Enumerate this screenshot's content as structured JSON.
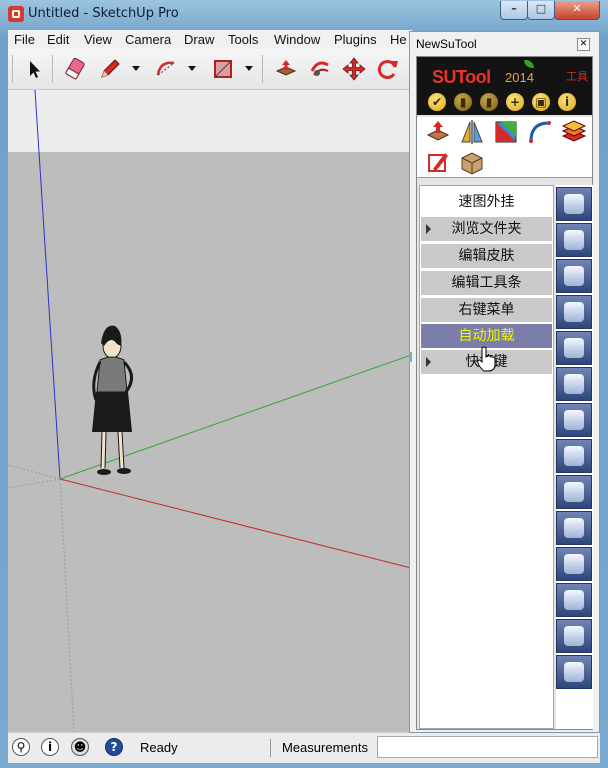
{
  "window": {
    "title": "Untitled - SketchUp Pro"
  },
  "menu": [
    "File",
    "Edit",
    "View",
    "Camera",
    "Draw",
    "Tools",
    "Window",
    "Plugins",
    "He"
  ],
  "toolbar": {
    "tools": [
      "select-tool",
      "eraser-tool",
      "pencil-tool",
      "arc-tool",
      "rectangle-tool",
      "push-pull-tool",
      "follow-me-tool",
      "move-tool",
      "rotate-tool"
    ]
  },
  "status": {
    "ready": "Ready",
    "measurements_label": "Measurements",
    "measurements_value": ""
  },
  "panel": {
    "title": "NewSuTool",
    "brand": "SUTool",
    "year": "2014",
    "tool_label": "工具",
    "quick_buttons": [
      "✔",
      "▮",
      "▮",
      "+",
      "▣",
      "i"
    ],
    "icon_grid": [
      "upload-arrow",
      "mirror-triangle",
      "map-square",
      "arc-curve",
      "layers",
      "pen-brush",
      "box-tool"
    ],
    "menu_items": [
      {
        "label": "速图外挂",
        "has_arrow": false,
        "style": "plain"
      },
      {
        "label": "浏览文件夹",
        "has_arrow": true,
        "style": "grey"
      },
      {
        "label": "编辑皮肤",
        "has_arrow": false,
        "style": "grey"
      },
      {
        "label": "编辑工具条",
        "has_arrow": false,
        "style": "grey"
      },
      {
        "label": "右键菜单",
        "has_arrow": false,
        "style": "grey"
      },
      {
        "label": "自动加载",
        "has_arrow": false,
        "style": "highlight"
      },
      {
        "label": "快捷键",
        "has_arrow": true,
        "style": "grey"
      }
    ],
    "colors": {
      "highlight_bg": "#7a7ea8",
      "highlight_text": "#f5f500",
      "item_bg": "#c9c9c9"
    }
  }
}
